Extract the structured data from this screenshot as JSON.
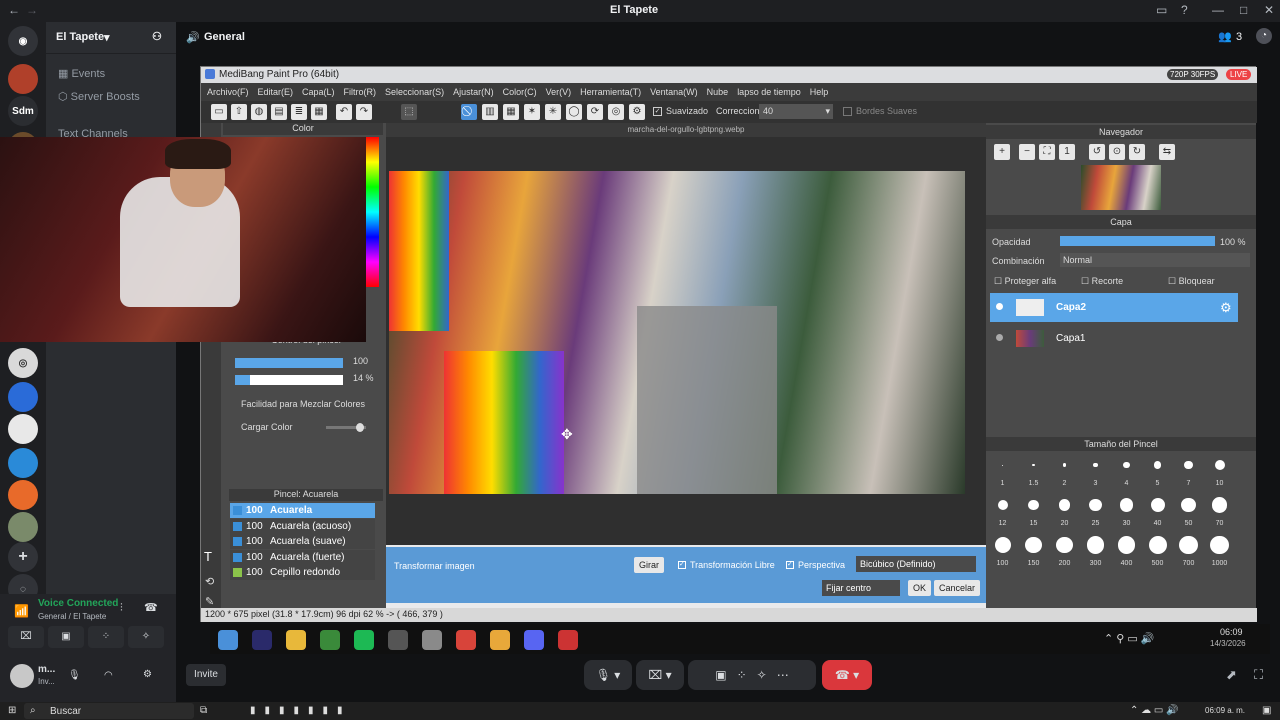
{
  "app": {
    "title": "El Tapete",
    "colors": {
      "bg": "#1e1f22",
      "accent": "#5865f2",
      "live": "#ed4245",
      "medibang_select": "#4a90d9"
    }
  },
  "server": {
    "name": "El Tapete",
    "channel": "General",
    "member_count": "3",
    "items": [
      "Events",
      "Server Boosts",
      "Text Channels"
    ]
  },
  "voice": {
    "status": "Voice Connected",
    "where": "General / El Tapete",
    "user": "m...",
    "user_sub": "Inv...",
    "invite": "Invite"
  },
  "medibang": {
    "title": "MediBang Paint Pro (64bit)",
    "badge_quality": "720P 30FPS",
    "badge_live": "LIVE",
    "menu": [
      "Archivo(F)",
      "Editar(E)",
      "Capa(L)",
      "Filtro(R)",
      "Seleccionar(S)",
      "Ajustar(N)",
      "Color(C)",
      "Ver(V)",
      "Herramienta(T)",
      "Ventana(W)",
      "Nube",
      "lapso de tiempo",
      "Help"
    ],
    "toolbar": {
      "suavizado": "Suavizado",
      "correccion": "Correccion",
      "correccion_value": "40",
      "bordes": "Bordes Suaves"
    },
    "doc_tab": "marcha-del-orgullo-lgbtpng.webp",
    "color_panel": "Color",
    "brush_control": {
      "title": "Control del pincel",
      "size": "100",
      "opacity": "14 %",
      "mix": "Facilidad para Mezclar Colores",
      "load": "Cargar Color"
    },
    "brush_panel": {
      "title": "Pincel: Acuarela",
      "items": [
        {
          "size": "100",
          "name": "Acuarela",
          "color": "#3a8fd8"
        },
        {
          "size": "100",
          "name": "Acuarela (acuoso)",
          "color": "#3a8fd8"
        },
        {
          "size": "100",
          "name": "Acuarela (suave)",
          "color": "#3a8fd8"
        },
        {
          "size": "100",
          "name": "Acuarela (fuerte)",
          "color": "#3a8fd8"
        },
        {
          "size": "100",
          "name": "Cepillo redondo",
          "color": "#8bc34a"
        }
      ]
    },
    "transform": {
      "label": "Transformar imagen",
      "girar": "Girar",
      "libre": "Transformación Libre",
      "perspectiva": "Perspectiva",
      "interp": "Bicúbico (Definido)",
      "fijar": "Fijar centro",
      "ok": "OK",
      "cancel": "Cancelar"
    },
    "navigator": "Navegador",
    "layer": {
      "title": "Capa",
      "opacity_label": "Opacidad",
      "opacity": "100 %",
      "opacity_value": 1.0,
      "blend_label": "Combinación",
      "blend": "Normal",
      "alpha": "Proteger alfa",
      "clip": "Recorte",
      "lock": "Bloquear",
      "layers": [
        "Capa2",
        "Capa1"
      ]
    },
    "brush_size": {
      "title": "Tamaño del Pincel",
      "sizes": [
        "1",
        "1.5",
        "2",
        "3",
        "4",
        "5",
        "7",
        "10",
        "12",
        "15",
        "20",
        "25",
        "30",
        "40",
        "50",
        "70",
        "100",
        "150",
        "200",
        "300",
        "400",
        "500",
        "700",
        "1000"
      ]
    },
    "status": "1200 * 675 pixel  (31.8 * 17.9cm)  96 dpi  62 %  -> ( 466, 379 )"
  },
  "inner_taskbar": {
    "time": "06:09",
    "date": "14/3/2026"
  },
  "windows": {
    "search": "Buscar",
    "time": "06:09 a. m."
  }
}
